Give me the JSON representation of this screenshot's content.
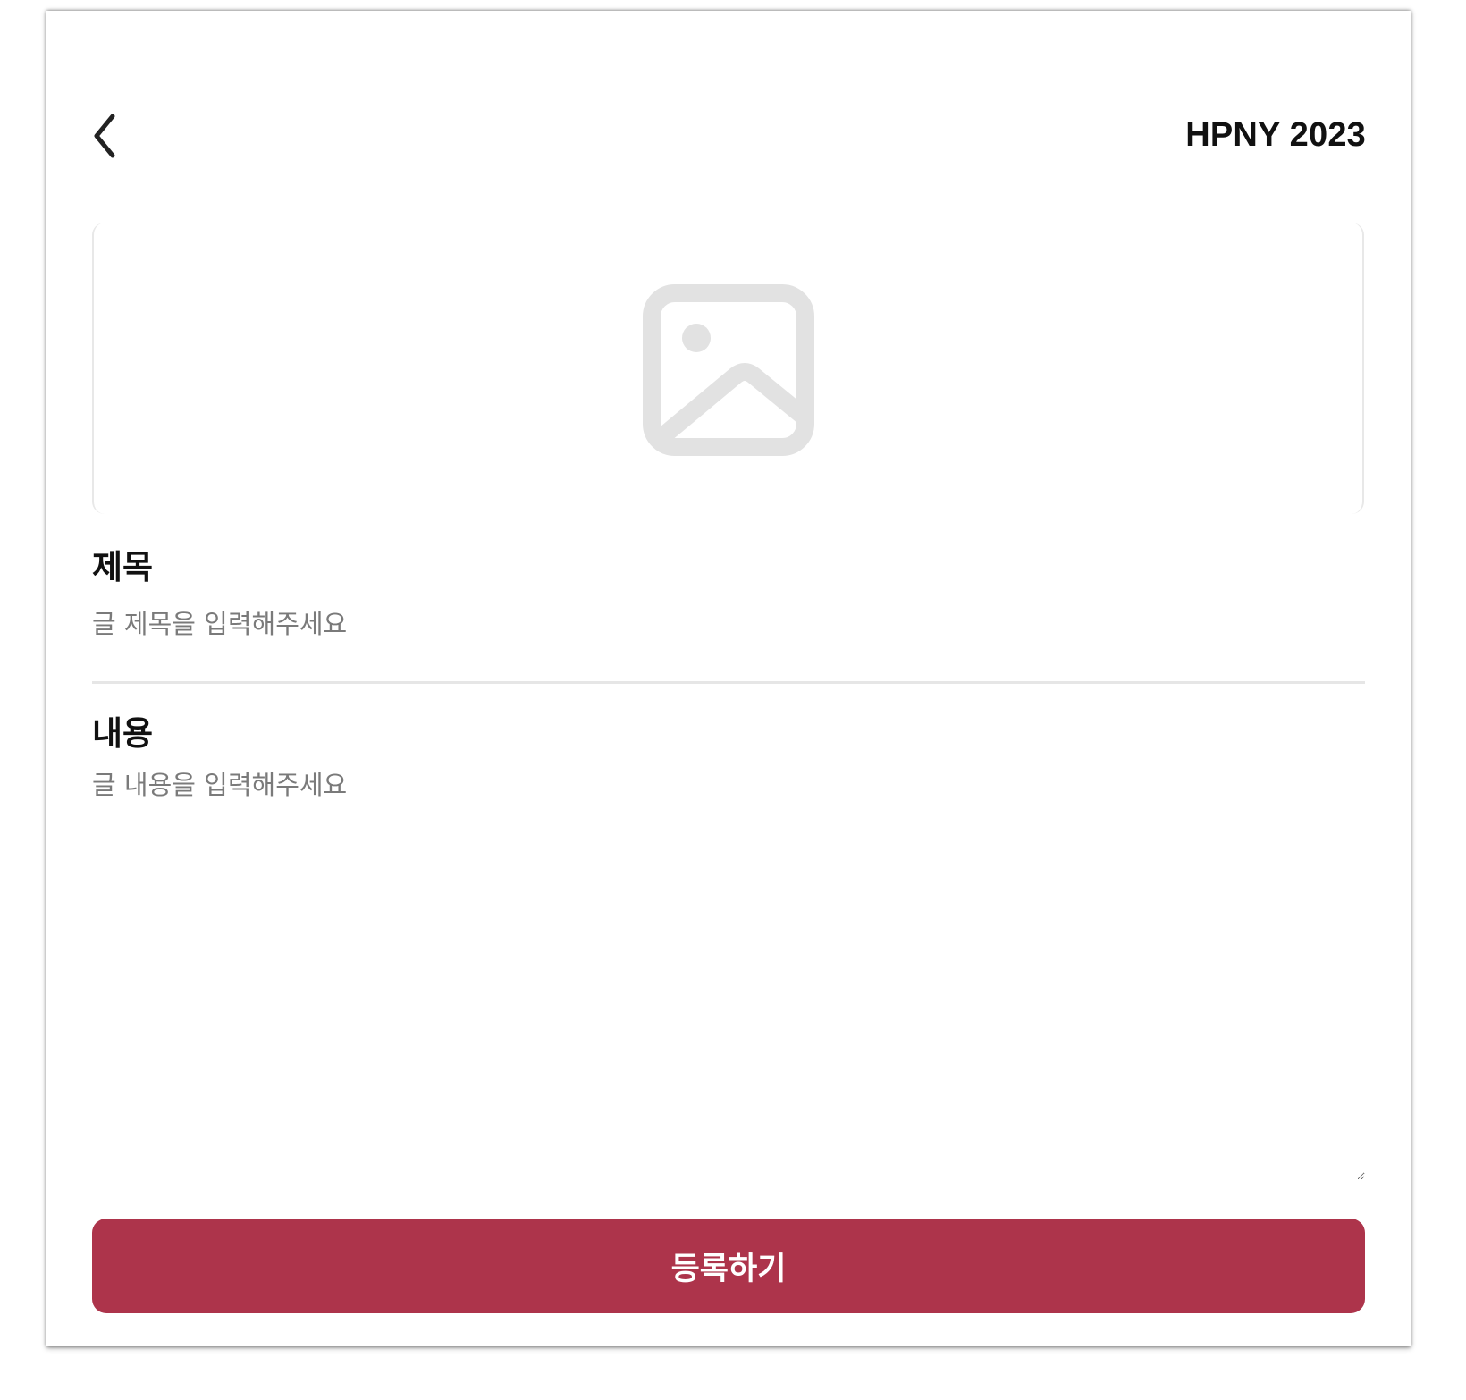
{
  "header": {
    "back_icon": "chevron-left-icon",
    "title": "HPNY 2023"
  },
  "image_upload": {
    "icon": "image-placeholder-icon",
    "icon_color": "#e2e2e2"
  },
  "form": {
    "title_label": "제목",
    "title_value": "",
    "title_placeholder": "글 제목을 입력해주세요",
    "content_label": "내용",
    "content_value": "",
    "content_placeholder": "글 내용을 입력해주세요"
  },
  "submit": {
    "label": "등록하기",
    "color": "#ad344b"
  }
}
